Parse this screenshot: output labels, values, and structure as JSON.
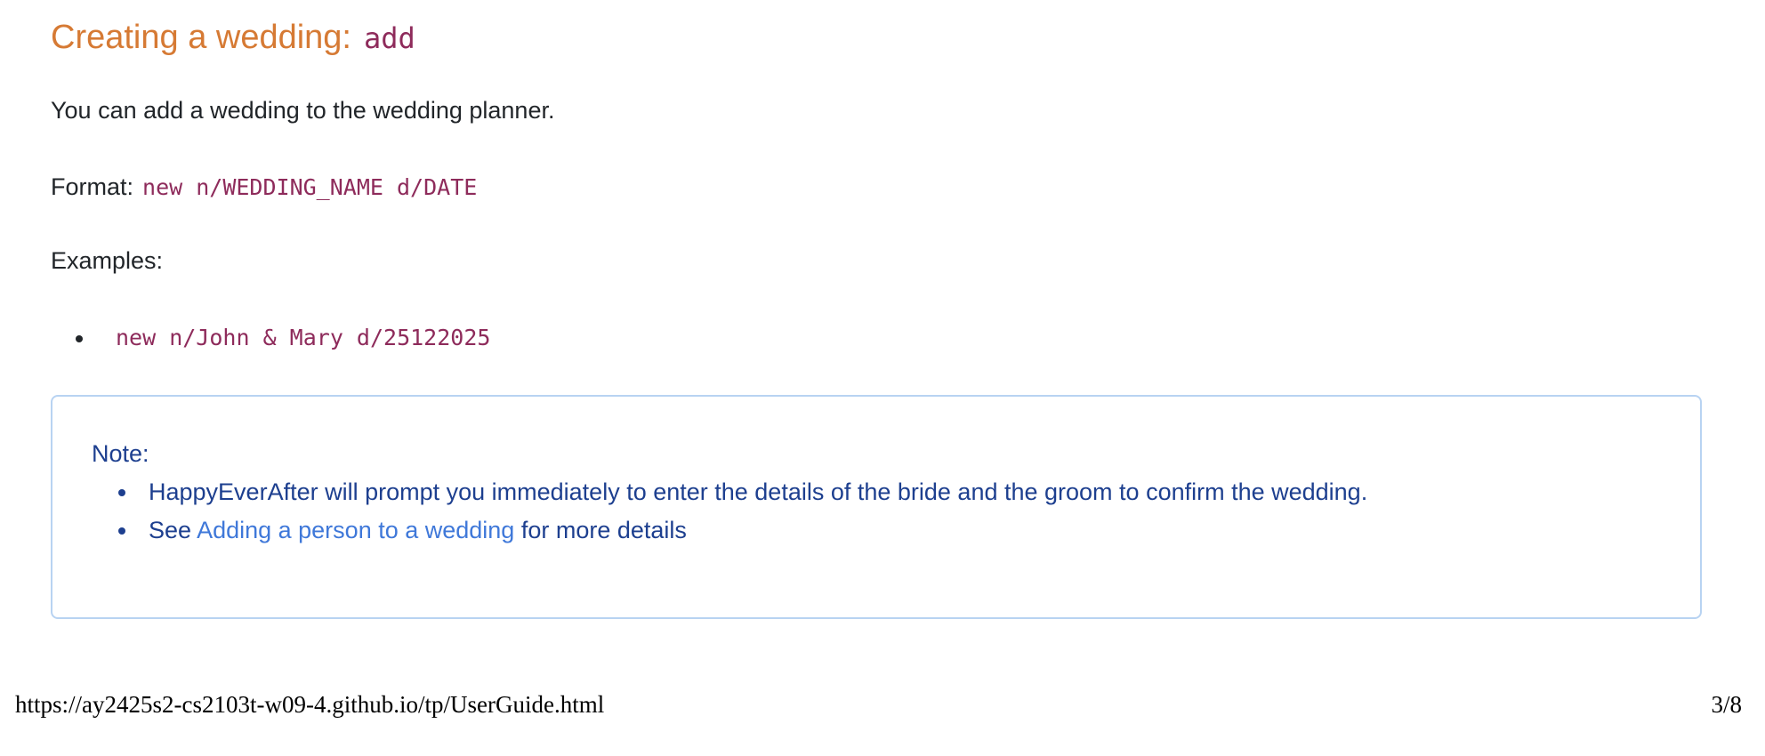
{
  "section": {
    "title": "Creating a wedding:",
    "command": "add"
  },
  "intro": "You can add a wedding to the wedding planner.",
  "format": {
    "label": "Format:",
    "code": "new n/WEDDING_NAME d/DATE"
  },
  "examples": {
    "label": "Examples:",
    "items": [
      "new n/John & Mary d/25122025"
    ]
  },
  "note": {
    "title": "Note:",
    "item_1": "HappyEverAfter will prompt you immediately to enter the details of the bride and the groom to confirm the wedding.",
    "item_2": {
      "prefix": "See",
      "link": "Adding a person to a wedding",
      "suffix": "for more details"
    }
  },
  "footer": {
    "url": "https://ay2425s2-cs2103t-w09-4.github.io/tp/UserGuide.html",
    "page": "3/8"
  },
  "colors": {
    "heading": "#d67a34",
    "code": "#8e2b5b",
    "note_text": "#1d3f8f",
    "note_border": "#b8d3f2",
    "link": "#3f78d9"
  }
}
